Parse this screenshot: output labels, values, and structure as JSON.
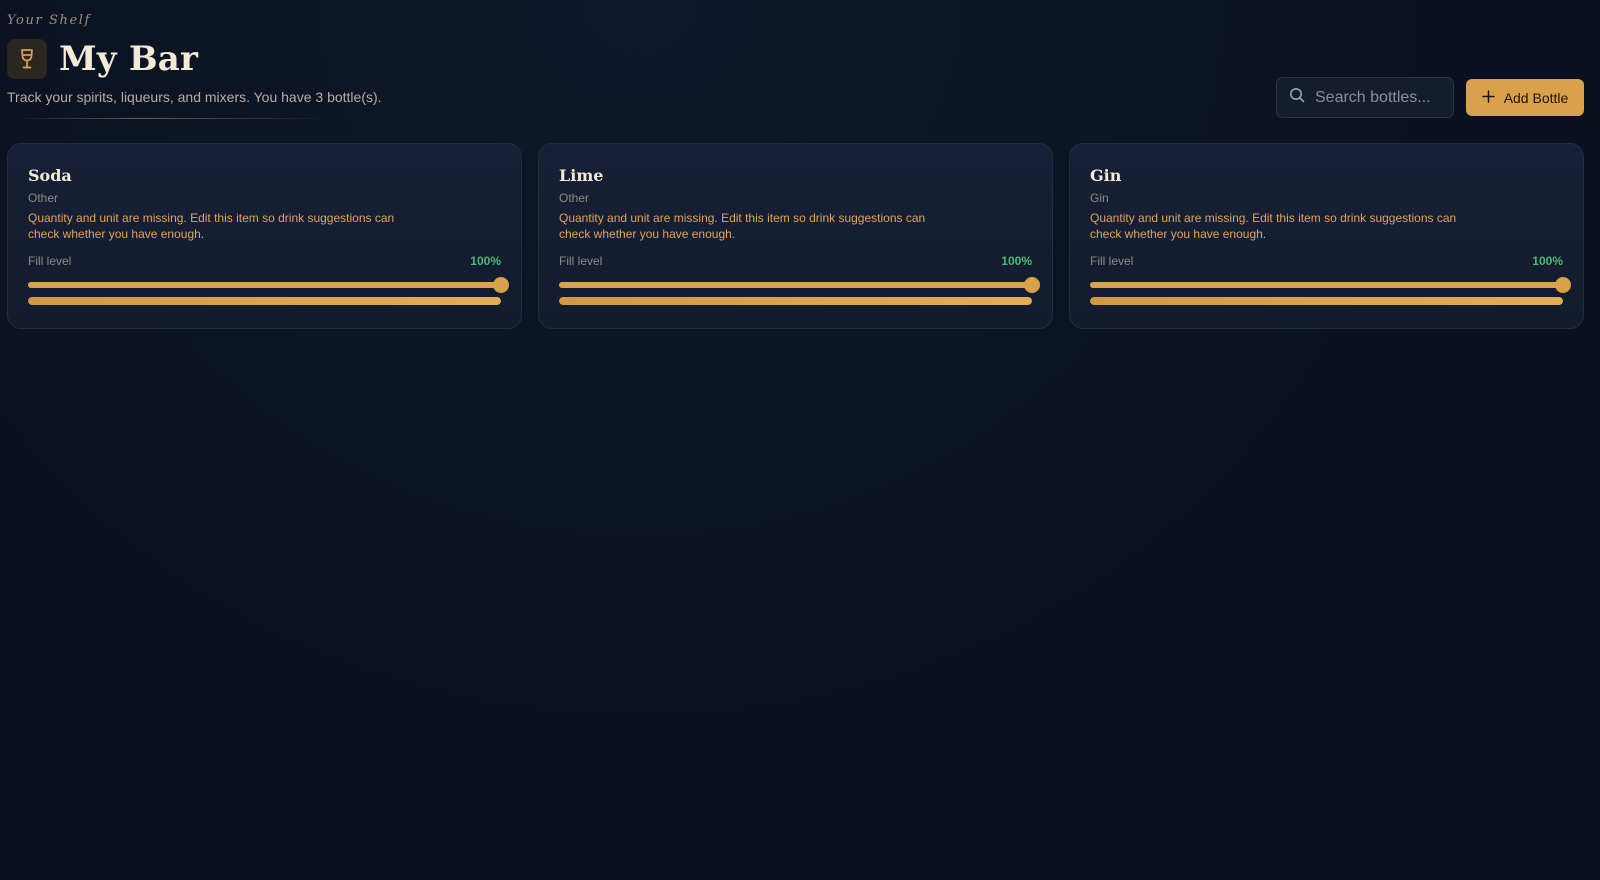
{
  "header": {
    "eyebrow": "Your Shelf",
    "title": "My Bar",
    "subtitle": "Track your spirits, liqueurs, and mixers. You have 3 bottle(s).",
    "logo_icon": "wine-glass-icon"
  },
  "search": {
    "placeholder": "Search bottles...",
    "value": "",
    "icon": "search-icon"
  },
  "add_button": {
    "label": "Add Bottle",
    "icon": "plus-icon"
  },
  "colors": {
    "accent": "#d9a24a",
    "background": "#0b1120",
    "card": "#172036",
    "warning_text": "#e1a45a",
    "fill_value": "#4fb872"
  },
  "bottles": [
    {
      "name": "Soda",
      "category": "Other",
      "warning": "Quantity and unit are missing. Edit this item so drink suggestions can check whether you have enough.",
      "fill_label": "Fill level",
      "fill_text": "100%",
      "fill_level": 1.0
    },
    {
      "name": "Lime",
      "category": "Other",
      "warning": "Quantity and unit are missing. Edit this item so drink suggestions can check whether you have enough.",
      "fill_label": "Fill level",
      "fill_text": "100%",
      "fill_level": 1.0
    },
    {
      "name": "Gin",
      "category": "Gin",
      "warning": "Quantity and unit are missing. Edit this item so drink suggestions can check whether you have enough.",
      "fill_label": "Fill level",
      "fill_text": "100%",
      "fill_level": 1.0
    }
  ]
}
